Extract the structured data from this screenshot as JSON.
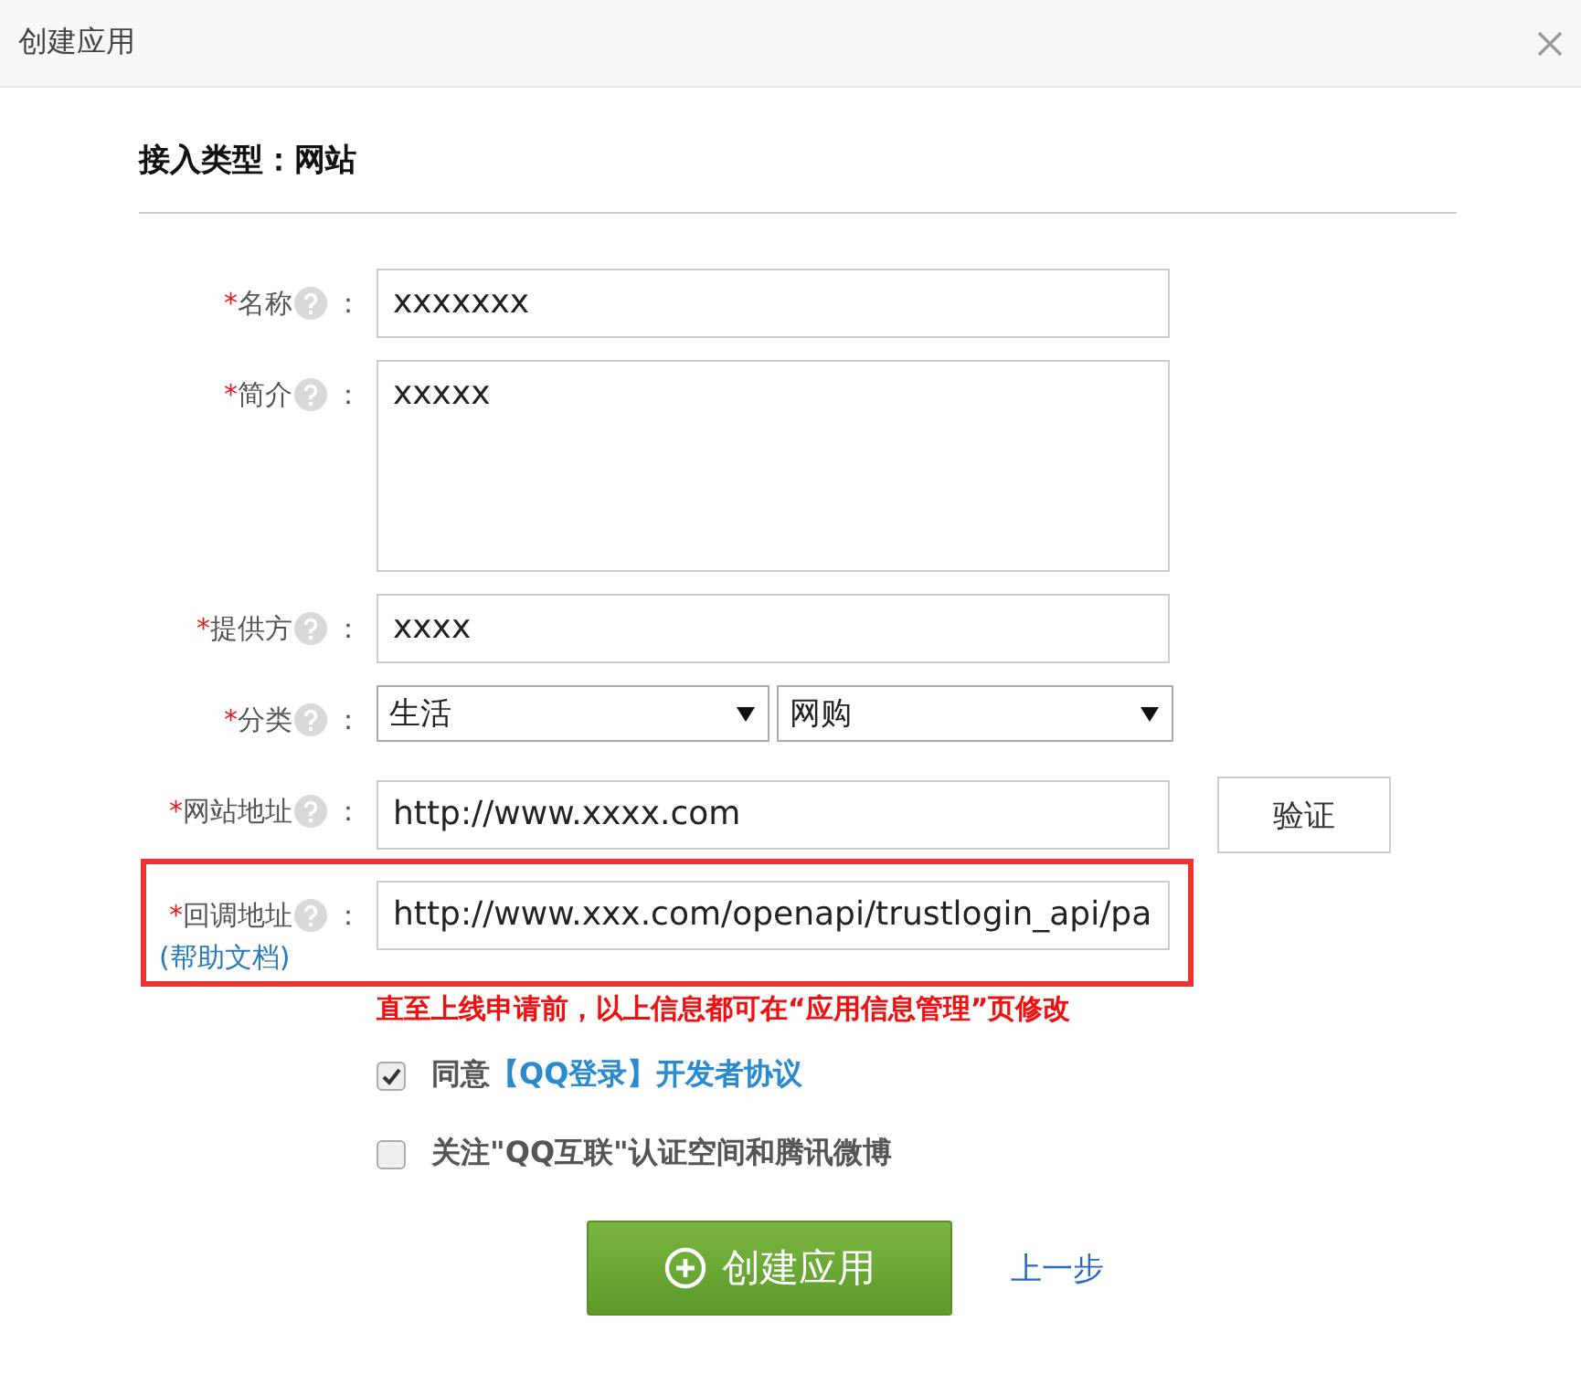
{
  "dialog": {
    "title": "创建应用"
  },
  "section": {
    "title": "接入类型：网站"
  },
  "fields": [
    {
      "kind": "input",
      "mark": "*",
      "label": "名称",
      "colon": "：",
      "value": "xxxxxxx",
      "highlighted": false
    },
    {
      "kind": "textarea",
      "mark": "*",
      "label": "简介",
      "colon": "：",
      "value": "xxxxx",
      "highlighted": false
    },
    {
      "kind": "input",
      "mark": "*",
      "label": "提供方",
      "colon": "：",
      "value": "xxxx",
      "highlighted": false
    },
    {
      "kind": "selects",
      "mark": "*",
      "label": "分类",
      "colon": "：",
      "options": [
        "生活",
        "网购"
      ],
      "highlighted": false
    },
    {
      "kind": "input_button",
      "mark": "*",
      "label": "网站地址",
      "colon": "：",
      "value": "http://www.xxxx.com",
      "button": "验证",
      "highlighted": false
    },
    {
      "kind": "input",
      "mark": "*",
      "label": "回调地址",
      "colon": "：",
      "value": "http://www.xxx.com/openapi/trustlogin_api/pa",
      "help_link": "(帮助文档)",
      "highlighted": true
    }
  ],
  "notice": "直至上线申请前，以上信息都可在“应用信息管理”页修改",
  "checkboxes": [
    {
      "checked": true,
      "text": "同意",
      "link": "【QQ登录】开发者协议"
    },
    {
      "checked": false,
      "text": "关注\"QQ互联\"认证空间和腾讯微博"
    }
  ],
  "submit": "创建应用",
  "back": "上一步"
}
